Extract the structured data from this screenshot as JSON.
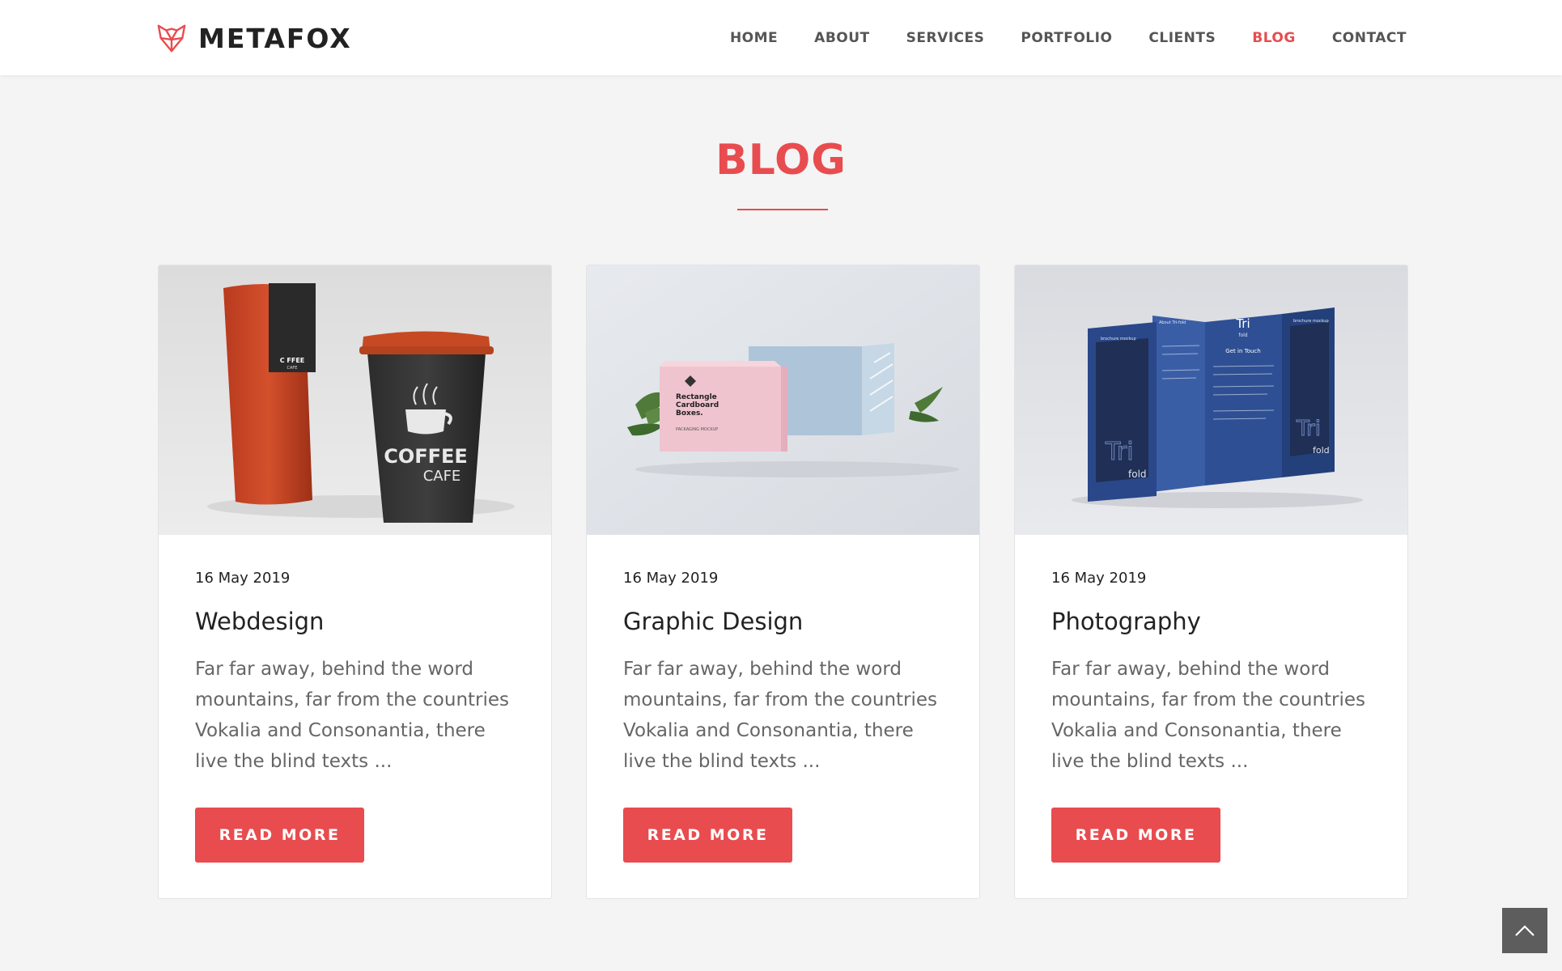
{
  "brand": {
    "name": "METAFOX",
    "logo_icon": "fox-head-icon"
  },
  "nav": {
    "items": [
      {
        "label": "HOME"
      },
      {
        "label": "ABOUT"
      },
      {
        "label": "SERVICES"
      },
      {
        "label": "PORTFOLIO"
      },
      {
        "label": "CLIENTS"
      },
      {
        "label": "BLOG",
        "active": true
      },
      {
        "label": "CONTACT"
      }
    ]
  },
  "section": {
    "title": "BLOG"
  },
  "posts": [
    {
      "date": "16 May 2019",
      "title": "Webdesign",
      "excerpt": "Far far away, behind the word mountains, far from the countries Vokalia and Consonantia, there live the blind texts ...",
      "button": "READ MORE",
      "image": {
        "bag_label_top": "C FFEE",
        "bag_label_bottom": "CAFE",
        "cup_label_top": "COFFEE",
        "cup_label_bottom": "CAFE"
      }
    },
    {
      "date": "16 May 2019",
      "title": "Graphic Design",
      "excerpt": "Far far away, behind the word mountains, far from the countries Vokalia and Consonantia, there live the blind texts ...",
      "button": "READ MORE",
      "image": {
        "box_label_1": "Rectangle",
        "box_label_2": "Cardboard",
        "box_label_3": "Boxes.",
        "box_sub": "PACKAGING MOCKUP"
      }
    },
    {
      "date": "16 May 2019",
      "title": "Photography",
      "excerpt": "Far far away, behind the word mountains, far from the countries Vokalia and Consonantia, there live the blind texts ...",
      "button": "READ MORE",
      "image": {
        "panel_title": "Tri",
        "panel_sub": "fold",
        "panel_heading": "Get in Touch",
        "panel_left": "brochure mockup",
        "panel_right": "brochure mockup",
        "about": "About Tri-fold"
      }
    }
  ],
  "colors": {
    "accent": "#e84c4f",
    "background": "#f4f4f4",
    "text_dark": "#222222",
    "text_muted": "#666666"
  },
  "back_to_top": {
    "icon": "chevron-up-icon"
  }
}
